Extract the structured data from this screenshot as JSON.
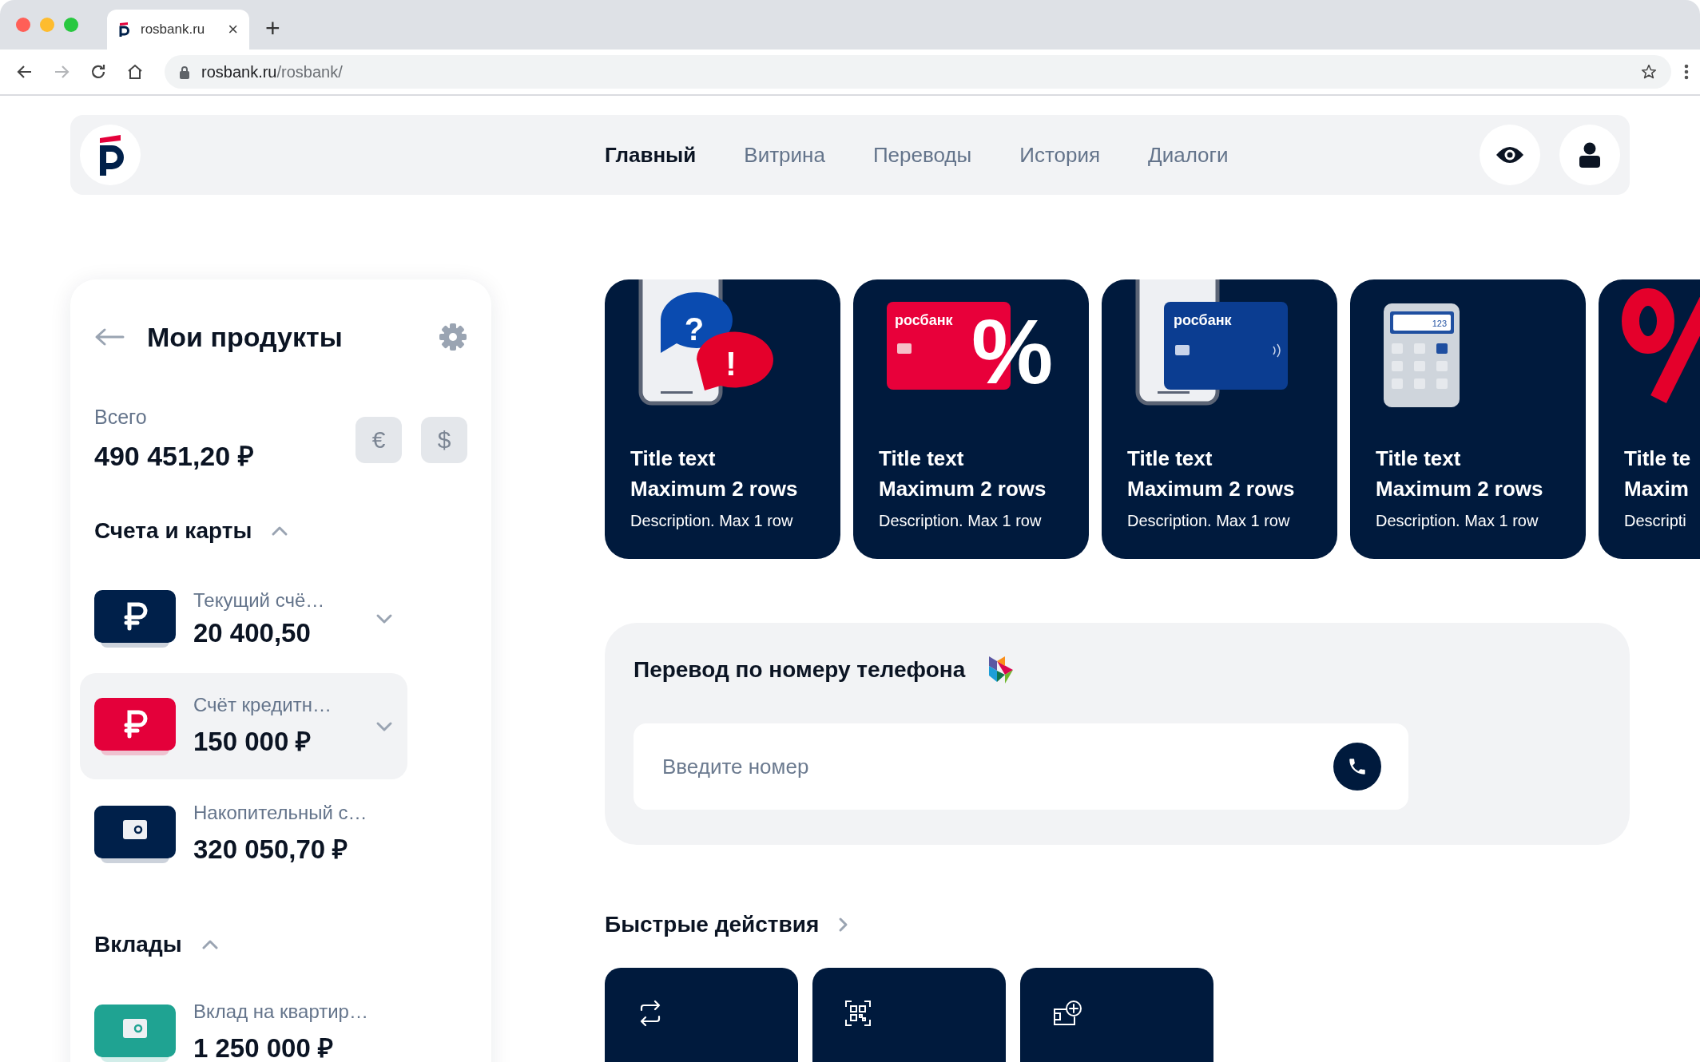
{
  "browser": {
    "tab": {
      "title": "rosbank.ru",
      "close": "×"
    },
    "new_tab": "+",
    "url_host": "rosbank.ru",
    "url_path": "/rosbank/",
    "forward_disabled": true
  },
  "header": {
    "nav": [
      {
        "label": "Главный",
        "selected": true
      },
      {
        "label": "Витрина",
        "selected": false
      },
      {
        "label": "Переводы",
        "selected": false
      },
      {
        "label": "История",
        "selected": false
      },
      {
        "label": "Диалоги",
        "selected": false
      }
    ]
  },
  "products": {
    "title": "Мои продукты",
    "total_label": "Всего",
    "total": "490 451,20 ₽",
    "currencies": [
      "€",
      "$"
    ],
    "groups": [
      {
        "title": "Счета и карты",
        "expanded": true,
        "items": [
          {
            "kind": "ruble",
            "color": "#00204a",
            "name": "Текущий счё…",
            "amount": "20 400,50",
            "selected": false,
            "expandable": true
          },
          {
            "kind": "ruble",
            "color": "#e4003a",
            "name": "Счёт кредитн…",
            "amount": "150 000 ₽",
            "selected": true,
            "expandable": true
          },
          {
            "kind": "safe",
            "color": "#00204a",
            "name": "Накопительный с…",
            "amount": "320 050,70 ₽",
            "selected": false,
            "expandable": false
          }
        ]
      },
      {
        "title": "Вклады",
        "expanded": true,
        "items": [
          {
            "kind": "safe",
            "color": "#1fa392",
            "name": "Вклад на квартир…",
            "amount": "1 250 000 ₽",
            "selected": false,
            "expandable": false
          }
        ]
      }
    ]
  },
  "promo_cards": [
    {
      "kind": "chat",
      "art_labels": [
        "?",
        "!"
      ],
      "title_lines": [
        "Title text",
        "Maximum 2 rows"
      ],
      "description": "Description. Max 1 row"
    },
    {
      "kind": "red-card",
      "art_labels": [
        "росбанк",
        "%"
      ],
      "title_lines": [
        "Title text",
        "Maximum 2 rows"
      ],
      "description": "Description. Max 1 row"
    },
    {
      "kind": "blue-card",
      "art_labels": [
        "росбанк"
      ],
      "title_lines": [
        "Title text",
        "Maximum 2 rows"
      ],
      "description": "Description. Max 1 row"
    },
    {
      "kind": "calculator",
      "art_labels": [
        "123"
      ],
      "title_lines": [
        "Title text",
        "Maximum 2 rows"
      ],
      "description": "Description. Max 1 row"
    },
    {
      "kind": "percent",
      "title_lines": [
        "Title te",
        "Maxim"
      ],
      "description": "Descripti"
    }
  ],
  "transfer": {
    "title": "Перевод по номеру телефона",
    "placeholder": "Введите номер"
  },
  "quick_actions": {
    "title": "Быстрые действия",
    "items": [
      {
        "kind": "swap"
      },
      {
        "kind": "qr"
      },
      {
        "kind": "wallet-plus"
      }
    ]
  }
}
